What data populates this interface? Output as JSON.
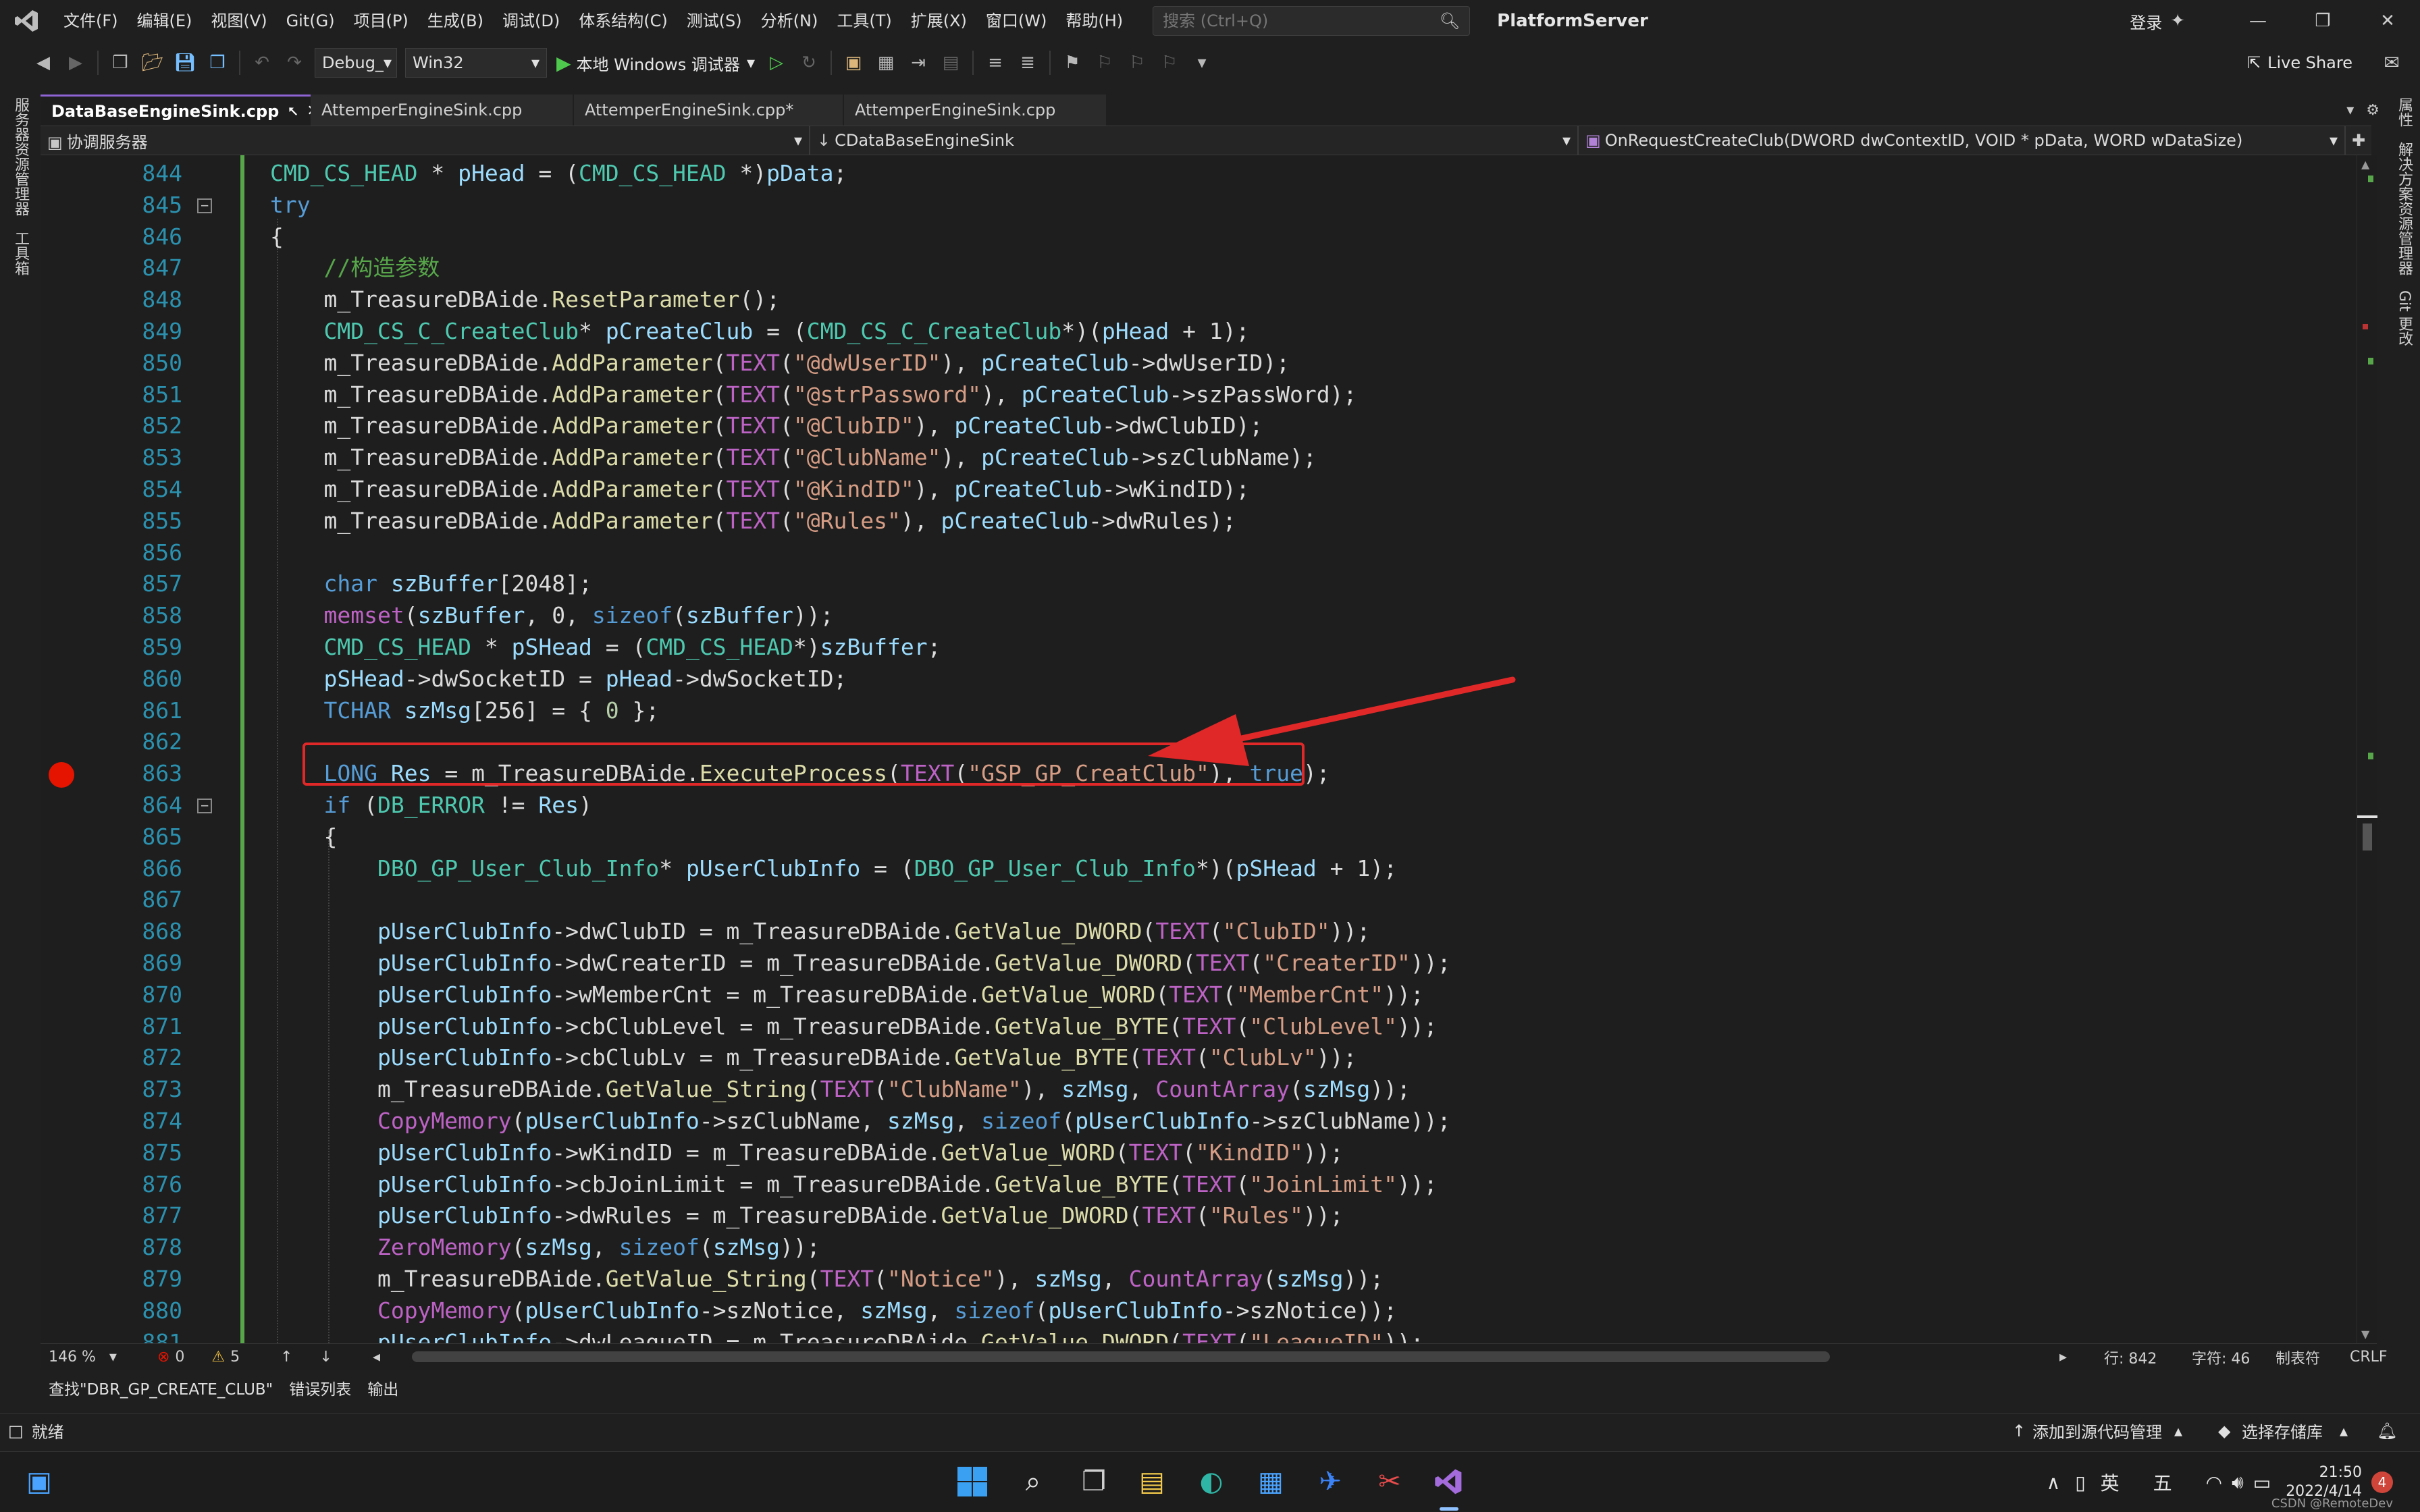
{
  "menubar": {
    "items": [
      "文件(F)",
      "编辑(E)",
      "视图(V)",
      "Git(G)",
      "项目(P)",
      "生成(B)",
      "调试(D)",
      "体系结构(C)",
      "测试(S)",
      "分析(N)",
      "工具(T)",
      "扩展(X)",
      "窗口(W)",
      "帮助(H)"
    ],
    "search_placeholder": "搜索 (Ctrl+Q)",
    "solution_name": "PlatformServer",
    "login": "登录"
  },
  "toolbar": {
    "config": "Debug_",
    "platform": "Win32",
    "run_label": "本地 Windows 调试器",
    "live_share": "Live Share"
  },
  "left_dock": [
    "服务器资源管理器",
    "工具箱"
  ],
  "right_dock": [
    "属性",
    "解决方案资源管理器",
    "Git 更改"
  ],
  "tabs": [
    {
      "label": "DataBaseEngineSink.cpp",
      "active": true
    },
    {
      "label": "AttemperEngineSink.cpp",
      "active": false
    },
    {
      "label": "AttemperEngineSink.cpp*",
      "active": false
    },
    {
      "label": "AttemperEngineSink.cpp",
      "active": false
    }
  ],
  "navbar": {
    "project": "协调服务器",
    "class": "CDataBaseEngineSink",
    "member": "OnRequestCreateClub(DWORD dwContextID, VOID * pData, WORD wDataSize)"
  },
  "code_lines": [
    {
      "n": "844",
      "t": "CMD_CS_HEAD * pHead = (CMD_CS_HEAD *)pData;"
    },
    {
      "n": "845",
      "t": "try"
    },
    {
      "n": "846",
      "t": "{"
    },
    {
      "n": "847",
      "t": "    //构造参数"
    },
    {
      "n": "848",
      "t": "    m_TreasureDBAide.ResetParameter();"
    },
    {
      "n": "849",
      "t": "    CMD_CS_C_CreateClub* pCreateClub = (CMD_CS_C_CreateClub*)(pHead + 1);"
    },
    {
      "n": "850",
      "t": "    m_TreasureDBAide.AddParameter(TEXT(\"@dwUserID\"), pCreateClub->dwUserID);"
    },
    {
      "n": "851",
      "t": "    m_TreasureDBAide.AddParameter(TEXT(\"@strPassword\"), pCreateClub->szPassWord);"
    },
    {
      "n": "852",
      "t": "    m_TreasureDBAide.AddParameter(TEXT(\"@ClubID\"), pCreateClub->dwClubID);"
    },
    {
      "n": "853",
      "t": "    m_TreasureDBAide.AddParameter(TEXT(\"@ClubName\"), pCreateClub->szClubName);"
    },
    {
      "n": "854",
      "t": "    m_TreasureDBAide.AddParameter(TEXT(\"@KindID\"), pCreateClub->wKindID);"
    },
    {
      "n": "855",
      "t": "    m_TreasureDBAide.AddParameter(TEXT(\"@Rules\"), pCreateClub->dwRules);"
    },
    {
      "n": "856",
      "t": ""
    },
    {
      "n": "857",
      "t": "    char szBuffer[2048];"
    },
    {
      "n": "858",
      "t": "    memset(szBuffer, 0, sizeof(szBuffer));"
    },
    {
      "n": "859",
      "t": "    CMD_CS_HEAD * pSHead = (CMD_CS_HEAD*)szBuffer;"
    },
    {
      "n": "860",
      "t": "    pSHead->dwSocketID = pHead->dwSocketID;"
    },
    {
      "n": "861",
      "t": "    TCHAR szMsg[256] = { 0 };"
    },
    {
      "n": "862",
      "t": ""
    },
    {
      "n": "863",
      "t": "    LONG Res = m_TreasureDBAide.ExecuteProcess(TEXT(\"GSP_GP_CreatClub\"), true);"
    },
    {
      "n": "864",
      "t": "    if (DB_ERROR != Res)"
    },
    {
      "n": "865",
      "t": "    {"
    },
    {
      "n": "866",
      "t": "        DBO_GP_User_Club_Info* pUserClubInfo = (DBO_GP_User_Club_Info*)(pSHead + 1);"
    },
    {
      "n": "867",
      "t": ""
    },
    {
      "n": "868",
      "t": "        pUserClubInfo->dwClubID = m_TreasureDBAide.GetValue_DWORD(TEXT(\"ClubID\"));"
    },
    {
      "n": "869",
      "t": "        pUserClubInfo->dwCreaterID = m_TreasureDBAide.GetValue_DWORD(TEXT(\"CreaterID\"));"
    },
    {
      "n": "870",
      "t": "        pUserClubInfo->wMemberCnt = m_TreasureDBAide.GetValue_WORD(TEXT(\"MemberCnt\"));"
    },
    {
      "n": "871",
      "t": "        pUserClubInfo->cbClubLevel = m_TreasureDBAide.GetValue_BYTE(TEXT(\"ClubLevel\"));"
    },
    {
      "n": "872",
      "t": "        pUserClubInfo->cbClubLv = m_TreasureDBAide.GetValue_BYTE(TEXT(\"ClubLv\"));"
    },
    {
      "n": "873",
      "t": "        m_TreasureDBAide.GetValue_String(TEXT(\"ClubName\"), szMsg, CountArray(szMsg));"
    },
    {
      "n": "874",
      "t": "        CopyMemory(pUserClubInfo->szClubName, szMsg, sizeof(pUserClubInfo->szClubName));"
    },
    {
      "n": "875",
      "t": "        pUserClubInfo->wKindID = m_TreasureDBAide.GetValue_WORD(TEXT(\"KindID\"));"
    },
    {
      "n": "876",
      "t": "        pUserClubInfo->cbJoinLimit = m_TreasureDBAide.GetValue_BYTE(TEXT(\"JoinLimit\"));"
    },
    {
      "n": "877",
      "t": "        pUserClubInfo->dwRules = m_TreasureDBAide.GetValue_DWORD(TEXT(\"Rules\"));"
    },
    {
      "n": "878",
      "t": "        ZeroMemory(szMsg, sizeof(szMsg));"
    },
    {
      "n": "879",
      "t": "        m_TreasureDBAide.GetValue_String(TEXT(\"Notice\"), szMsg, CountArray(szMsg));"
    },
    {
      "n": "880",
      "t": "        CopyMemory(pUserClubInfo->szNotice, szMsg, sizeof(pUserClubInfo->szNotice));"
    },
    {
      "n": "881",
      "t": "        pUserClubInfo->dwLeagueID = m_TreasureDBAide.GetValue_DWORD(TEXT(\"LeagueID\"));"
    }
  ],
  "editor_status": {
    "zoom": "146 %",
    "errors": "0",
    "warnings": "5",
    "line": "行: 842",
    "col": "字符: 46",
    "tabs": "制表符",
    "eol": "CRLF"
  },
  "output_tabs": [
    "查找\"DBR_GP_CREATE_CLUB\"",
    "错误列表",
    "输出"
  ],
  "statusbar": {
    "ready": "就绪",
    "add_source": "添加到源代码管理",
    "select_repo": "选择存储库"
  },
  "taskbar": {
    "ime1": "英",
    "ime2": "五",
    "time": "21:50",
    "date": "2022/4/14",
    "watermark": "CSDN @RemoteDev",
    "badge": "4"
  },
  "colors": {
    "accent": "#8e63d3",
    "highlight_box": "#e02828",
    "breakpoint": "#e51400",
    "keyword": "#569cd6",
    "type": "#4ec9b0",
    "macro": "#bd63c5",
    "string": "#d69d85",
    "comment": "#57a64a",
    "line_number": "#2b91af"
  }
}
